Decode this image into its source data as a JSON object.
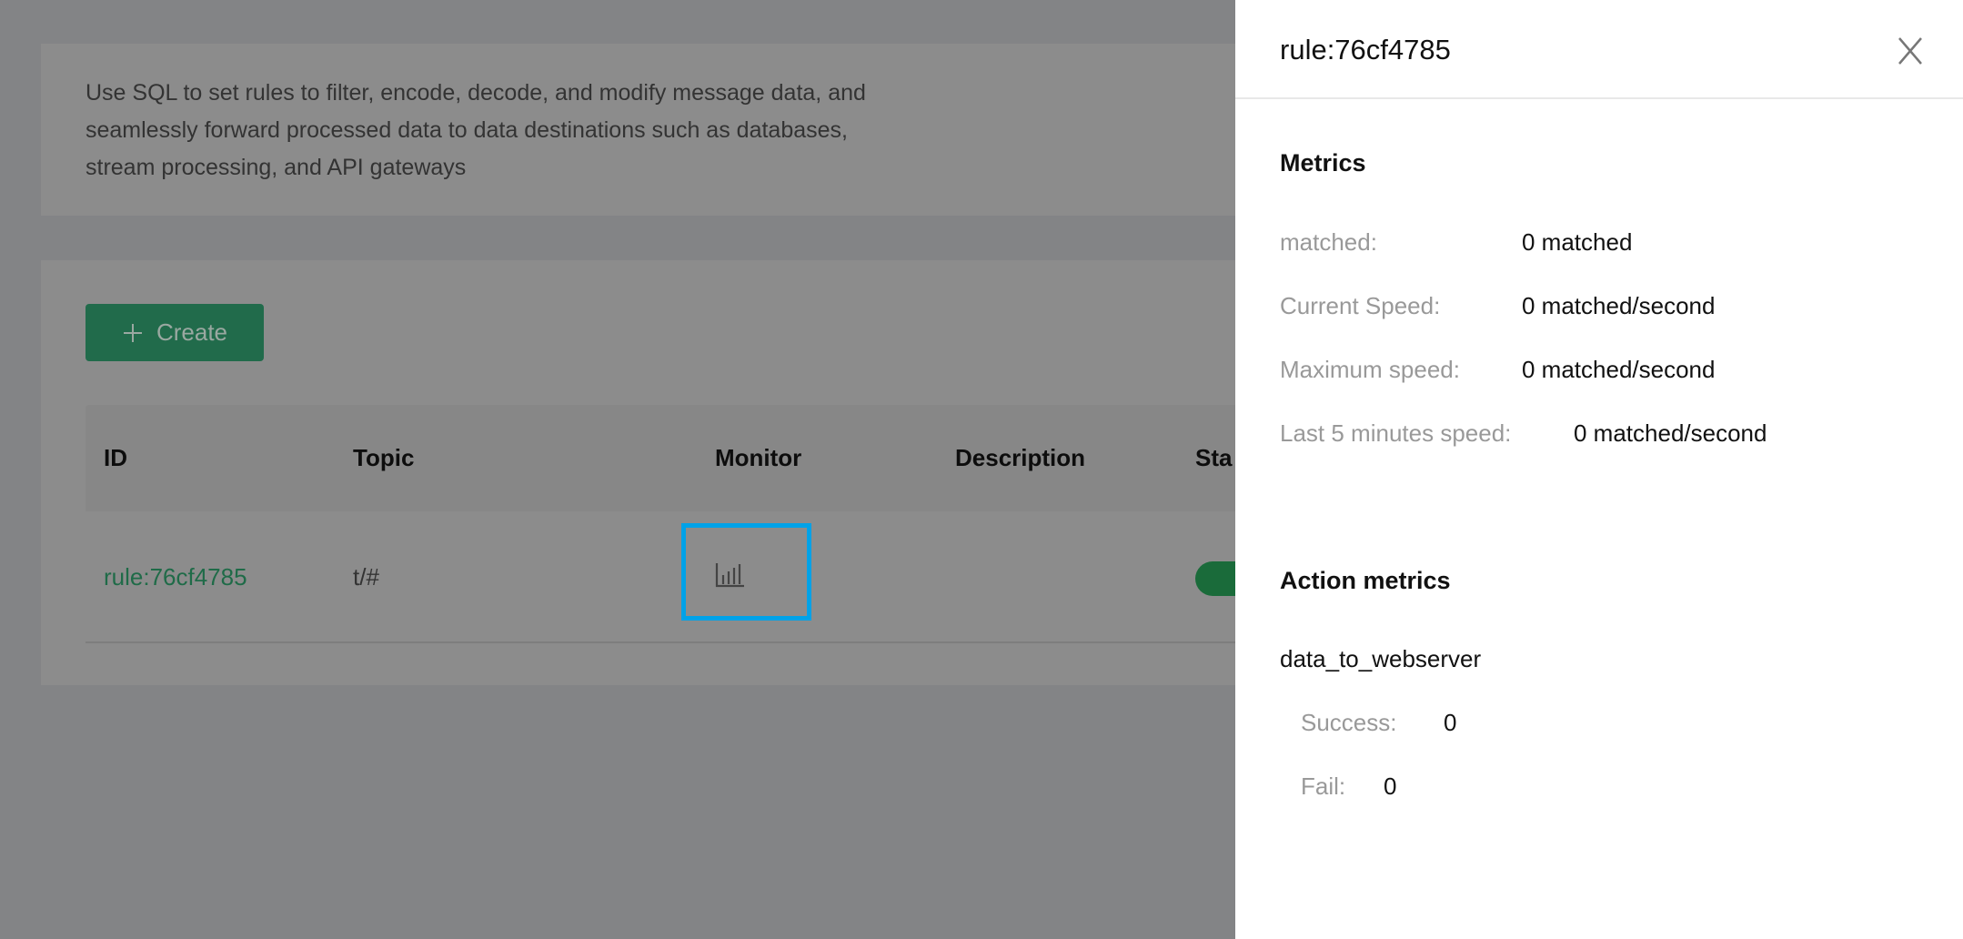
{
  "intro": {
    "description_lines": [
      "Use SQL to set rules to filter, encode, decode, and modify message data, and",
      "seamlessly forward processed data to data destinations such as databases,",
      "stream processing, and API gateways"
    ]
  },
  "toolbar": {
    "create_label": "Create",
    "create_icon": "plus-icon"
  },
  "table": {
    "columns": [
      "ID",
      "Topic",
      "Monitor",
      "Description",
      "Sta"
    ],
    "rows": [
      {
        "id": "rule:76cf4785",
        "topic": "t/#",
        "monitor_icon": "bar-chart-icon",
        "description": "",
        "status_enabled": true
      }
    ]
  },
  "drawer": {
    "title": "rule:76cf4785",
    "metrics_heading": "Metrics",
    "metrics": [
      {
        "label": "matched:",
        "value": "0 matched"
      },
      {
        "label": "Current Speed:",
        "value": "0 matched/second"
      },
      {
        "label": "Maximum speed:",
        "value": "0 matched/second"
      },
      {
        "label": "Last 5 minutes speed:",
        "value": "0 matched/second"
      }
    ],
    "action_metrics_heading": "Action metrics",
    "actions": [
      {
        "name": "data_to_webserver",
        "success_label": "Success:",
        "success": "0",
        "fail_label": "Fail:",
        "fail": "0"
      }
    ]
  },
  "colors": {
    "brand_green": "#34c388",
    "highlight_blue": "#00a2e8",
    "overlay": "#838486"
  }
}
